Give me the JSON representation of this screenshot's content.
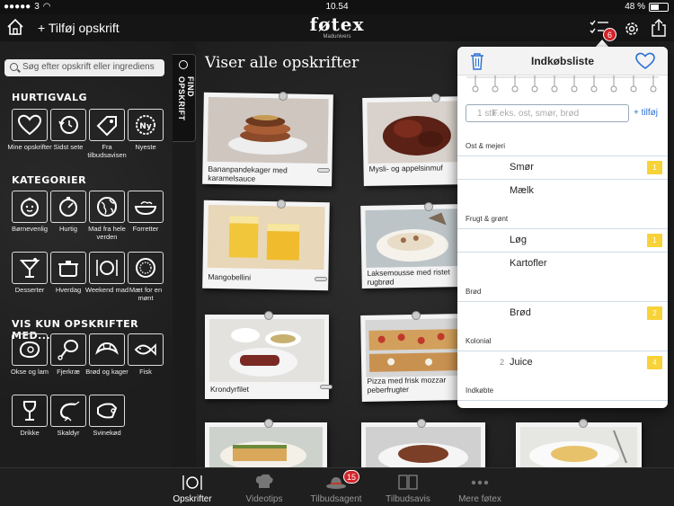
{
  "status": {
    "signal": "3",
    "time": "10.54",
    "battery": "48 %"
  },
  "nav": {
    "add_recipe": "+ Tilføj opskrift",
    "brand": "føtex",
    "brand_sub": "Madunivers",
    "list_badge": "6"
  },
  "sidebar": {
    "search_placeholder": "Søg efter opskrift eller ingrediens",
    "quick_title": "HURTIGVALG",
    "quick": [
      {
        "label": "Mine opskrifter",
        "icon": "heart-icon"
      },
      {
        "label": "Sidst sete",
        "icon": "history-icon"
      },
      {
        "label": "Fra tilbudsavisen",
        "icon": "price-tag-icon"
      },
      {
        "label": "Nyeste",
        "icon": "new-badge-icon"
      }
    ],
    "cat_title": "KATEGORIER",
    "categories": [
      {
        "label": "Børnevenlig",
        "icon": "child-face-icon"
      },
      {
        "label": "Hurtig",
        "icon": "stopwatch-icon"
      },
      {
        "label": "Mad fra hele verden",
        "icon": "globe-icon"
      },
      {
        "label": "Forretter",
        "icon": "starter-bowl-icon"
      },
      {
        "label": "Desserter",
        "icon": "dessert-glass-icon"
      },
      {
        "label": "Hverdag",
        "icon": "pot-icon"
      },
      {
        "label": "Weekend mad",
        "icon": "plate-cutlery-icon"
      },
      {
        "label": "Mæt for en mønt",
        "icon": "coin-icon"
      }
    ],
    "only_title": "VIS KUN OPSKRIFTER MED...",
    "only": [
      {
        "label": "Okse og lam",
        "icon": "steak-icon"
      },
      {
        "label": "Fjerkræ",
        "icon": "drumstick-icon"
      },
      {
        "label": "Brød og kager",
        "icon": "croissant-icon"
      },
      {
        "label": "Fisk",
        "icon": "fish-icon"
      },
      {
        "label": "Drikke",
        "icon": "wine-glass-icon"
      },
      {
        "label": "Skaldyr",
        "icon": "shrimp-icon"
      },
      {
        "label": "Svinekød",
        "icon": "ham-icon"
      }
    ]
  },
  "find_tab": "FIND OPSKRIFT",
  "main": {
    "heading": "Viser alle opskrifter",
    "recipes": [
      {
        "title": "Bananpandekager med karamelsauce"
      },
      {
        "title": "Mysli- og appelsinmuf"
      },
      {
        "title": "Mangobellini"
      },
      {
        "title": "Laksemousse med ristet rugbrød"
      },
      {
        "title": "Krondyrfilet"
      },
      {
        "title": "Pizza med frisk mozzar peberfrugter"
      }
    ]
  },
  "shopping": {
    "title": "Indkøbsliste",
    "qty_placeholder": "1 stk",
    "item_placeholder": "F.eks. ost, smør, brød",
    "add_label": "+ tilføj",
    "categories": [
      {
        "name": "Ost & mejeri",
        "items": [
          {
            "qty": "",
            "name": "Smør",
            "note": "1"
          },
          {
            "qty": "",
            "name": "Mælk",
            "note": ""
          }
        ]
      },
      {
        "name": "Frugt & grønt",
        "items": [
          {
            "qty": "",
            "name": "Løg",
            "note": "1"
          },
          {
            "qty": "",
            "name": "Kartofler",
            "note": ""
          }
        ]
      },
      {
        "name": "Brød",
        "items": [
          {
            "qty": "",
            "name": "Brød",
            "note": "2"
          }
        ]
      },
      {
        "name": "Kolonial",
        "items": [
          {
            "qty": "2",
            "name": "Juice",
            "note": "4"
          }
        ]
      },
      {
        "name": "Indkøbte",
        "items": []
      }
    ]
  },
  "tabs": [
    {
      "label": "Opskrifter",
      "icon": "plate-cutlery-icon"
    },
    {
      "label": "Videotips",
      "icon": "chef-hat-icon"
    },
    {
      "label": "Tilbudsagent",
      "icon": "agent-hat-icon",
      "badge": "15"
    },
    {
      "label": "Tilbudsavis",
      "icon": "open-book-icon"
    },
    {
      "label": "Mere føtex",
      "icon": "more-dots-icon"
    }
  ],
  "colors": {
    "accent_blue": "#2a6fd6",
    "badge_red": "#d2232a",
    "note_yellow": "#f7d239"
  }
}
